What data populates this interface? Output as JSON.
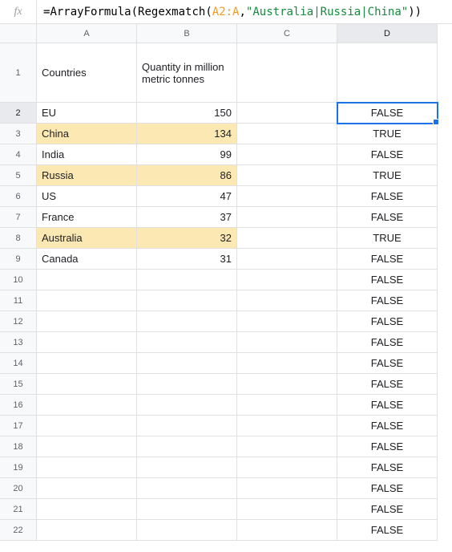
{
  "formula_bar": {
    "fx_label": "fx",
    "eq": "=",
    "fn1": "ArrayFormula",
    "fn2": "Regexmatch",
    "ref": "A2:A",
    "str": "\"Australia|Russia|China\""
  },
  "columns": [
    "A",
    "B",
    "C",
    "D"
  ],
  "header_row": {
    "A": "Countries",
    "B": "Quantity in million metric tonnes",
    "C": "",
    "D": ""
  },
  "rows": [
    {
      "n": 2,
      "A": "EU",
      "B": "150",
      "C": "",
      "D": "FALSE",
      "hl": false,
      "sel": true
    },
    {
      "n": 3,
      "A": "China",
      "B": "134",
      "C": "",
      "D": "TRUE",
      "hl": true
    },
    {
      "n": 4,
      "A": "India",
      "B": "99",
      "C": "",
      "D": "FALSE",
      "hl": false
    },
    {
      "n": 5,
      "A": "Russia",
      "B": "86",
      "C": "",
      "D": "TRUE",
      "hl": true
    },
    {
      "n": 6,
      "A": "US",
      "B": "47",
      "C": "",
      "D": "FALSE",
      "hl": false
    },
    {
      "n": 7,
      "A": "France",
      "B": "37",
      "C": "",
      "D": "FALSE",
      "hl": false
    },
    {
      "n": 8,
      "A": "Australia",
      "B": "32",
      "C": "",
      "D": "TRUE",
      "hl": true
    },
    {
      "n": 9,
      "A": "Canada",
      "B": "31",
      "C": "",
      "D": "FALSE",
      "hl": false
    },
    {
      "n": 10,
      "A": "",
      "B": "",
      "C": "",
      "D": "FALSE",
      "hl": false
    },
    {
      "n": 11,
      "A": "",
      "B": "",
      "C": "",
      "D": "FALSE",
      "hl": false
    },
    {
      "n": 12,
      "A": "",
      "B": "",
      "C": "",
      "D": "FALSE",
      "hl": false
    },
    {
      "n": 13,
      "A": "",
      "B": "",
      "C": "",
      "D": "FALSE",
      "hl": false
    },
    {
      "n": 14,
      "A": "",
      "B": "",
      "C": "",
      "D": "FALSE",
      "hl": false
    },
    {
      "n": 15,
      "A": "",
      "B": "",
      "C": "",
      "D": "FALSE",
      "hl": false
    },
    {
      "n": 16,
      "A": "",
      "B": "",
      "C": "",
      "D": "FALSE",
      "hl": false
    },
    {
      "n": 17,
      "A": "",
      "B": "",
      "C": "",
      "D": "FALSE",
      "hl": false
    },
    {
      "n": 18,
      "A": "",
      "B": "",
      "C": "",
      "D": "FALSE",
      "hl": false
    },
    {
      "n": 19,
      "A": "",
      "B": "",
      "C": "",
      "D": "FALSE",
      "hl": false
    },
    {
      "n": 20,
      "A": "",
      "B": "",
      "C": "",
      "D": "FALSE",
      "hl": false
    },
    {
      "n": 21,
      "A": "",
      "B": "",
      "C": "",
      "D": "FALSE",
      "hl": false
    },
    {
      "n": 22,
      "A": "",
      "B": "",
      "C": "",
      "D": "FALSE",
      "hl": false
    }
  ],
  "chart_data": {
    "type": "table",
    "title": "Quantity in million metric tonnes by country",
    "categories": [
      "EU",
      "China",
      "India",
      "Russia",
      "US",
      "France",
      "Australia",
      "Canada"
    ],
    "values": [
      150,
      134,
      99,
      86,
      47,
      37,
      32,
      31
    ],
    "highlighted": [
      "China",
      "Russia",
      "Australia"
    ]
  }
}
